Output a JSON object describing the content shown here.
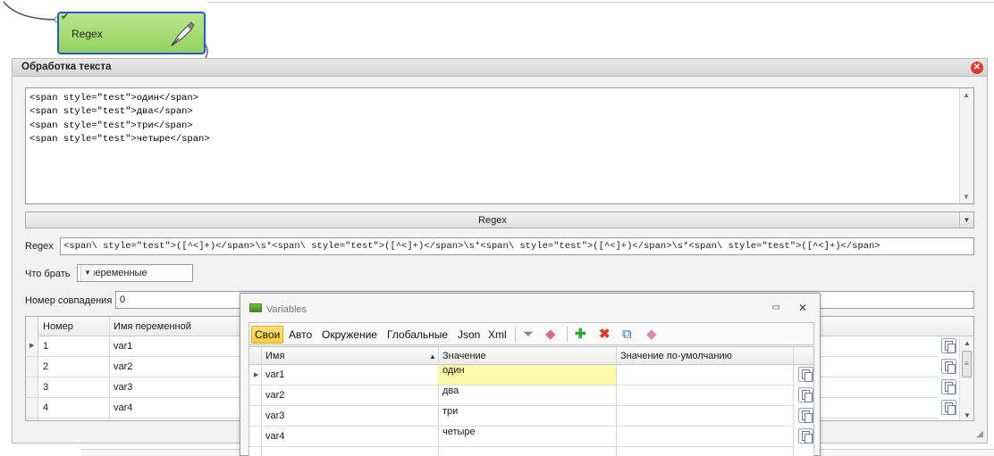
{
  "node": {
    "title": "Regex"
  },
  "dialog": {
    "title": "Обработка текста",
    "text_lines": [
      "<span style=\"test\">один</span>",
      "<span style=\"test\">два</span>",
      "<span style=\"test\">три</span>",
      "<span style=\"test\">четыре</span>"
    ],
    "mode_label": "Regex",
    "regex_label": "Regex",
    "regex_value": "<span\\ style=\"test\">([^<]+)</span>\\s*<span\\ style=\"test\">([^<]+)</span>\\s*<span\\ style=\"test\">([^<]+)</span>\\s*<span\\ style=\"test\">([^<]+)</span>",
    "take_label": "Что брать",
    "take_value": "В переменные",
    "match_label": "Номер совпадения",
    "match_value": "0",
    "grid": {
      "headers": [
        "Номер",
        "Имя переменной"
      ],
      "rows": [
        {
          "num": "1",
          "name": "var1"
        },
        {
          "num": "2",
          "name": "var2"
        },
        {
          "num": "3",
          "name": "var3"
        },
        {
          "num": "4",
          "name": "var4"
        }
      ]
    }
  },
  "variables_window": {
    "title": "Variables",
    "tabs": [
      "Свои",
      "Авто",
      "Окружение",
      "Глобальные",
      "Json",
      "Xml"
    ],
    "active_tab": "Свои",
    "headers": [
      "Имя",
      "Значение",
      "Значение по-умолчанию"
    ],
    "rows": [
      {
        "name": "var1",
        "value": "один",
        "default": ""
      },
      {
        "name": "var2",
        "value": "два",
        "default": ""
      },
      {
        "name": "var3",
        "value": "три",
        "default": ""
      },
      {
        "name": "var4",
        "value": "четыре",
        "default": ""
      }
    ]
  },
  "icons": {
    "close": "close-icon",
    "check": "check-icon",
    "pen": "pen-icon",
    "copy": "copy-icon",
    "filter": "filter-icon",
    "eraser": "eraser-icon",
    "add": "plus-icon",
    "delete": "x-icon",
    "rename": "rename-icon",
    "clear": "eraser-icon"
  },
  "colors": {
    "node_fill": "#a6dc78",
    "node_border": "#2c56c9",
    "active_tab": "#ffd34f",
    "highlight": "#fffaaa"
  }
}
